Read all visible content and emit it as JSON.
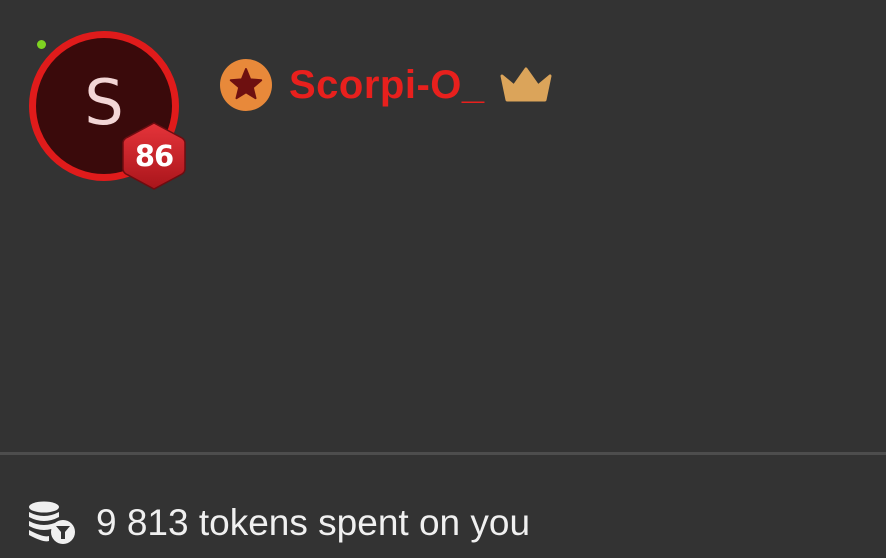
{
  "profile": {
    "avatar_letter": "S",
    "level": "86",
    "username": "Scorpi-O_",
    "online_status": "online",
    "rank_icon": "star-badge-icon",
    "vip_icon": "crown-icon"
  },
  "tokens": {
    "icon": "coins-icon",
    "text": "9 813 tokens spent on you"
  },
  "colors": {
    "background": "#333333",
    "avatar_ring": "#e01b1b",
    "avatar_fill": "#3a0a0b",
    "username": "#e8201d",
    "online_dot": "#7ed321",
    "rank_badge": "#e8893a",
    "crown": "#dba45a",
    "divider": "#4d4d4d"
  }
}
